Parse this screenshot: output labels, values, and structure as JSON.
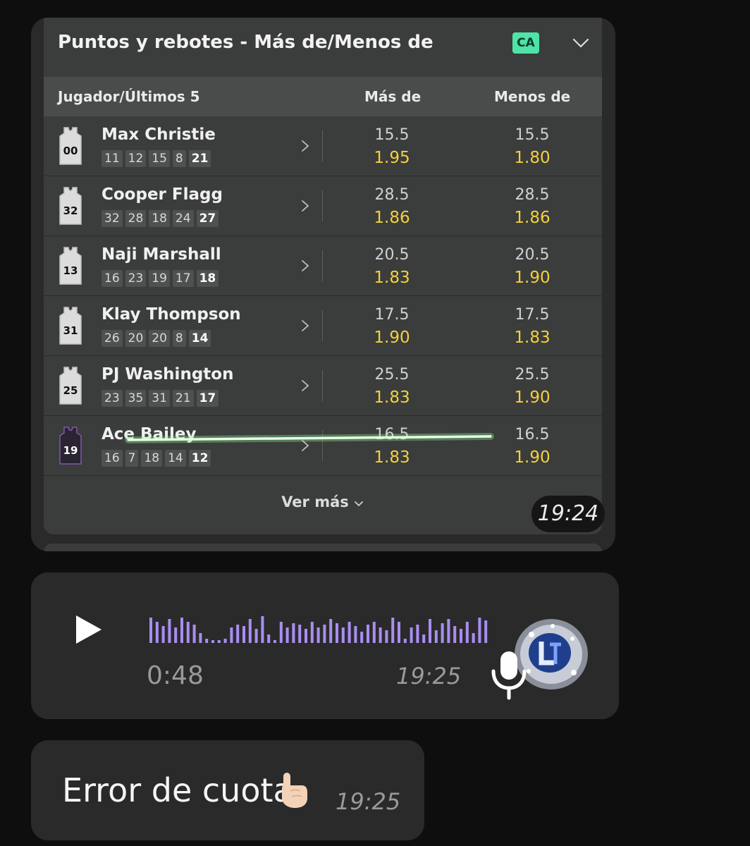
{
  "card": {
    "title": "Puntos y rebotes - Más de/Menos de",
    "badge": "CA",
    "header": {
      "player": "Jugador/Últimos 5",
      "over": "Más de",
      "under": "Menos de"
    },
    "rows": [
      {
        "name": "Max Christie",
        "jersey": "00",
        "last5": [
          "11",
          "12",
          "15",
          "8",
          "21"
        ],
        "over_line": "15.5",
        "over_odds": "1.95",
        "under_line": "15.5",
        "under_odds": "1.80"
      },
      {
        "name": "Cooper Flagg",
        "jersey": "32",
        "last5": [
          "32",
          "28",
          "18",
          "24",
          "27"
        ],
        "over_line": "28.5",
        "over_odds": "1.86",
        "under_line": "28.5",
        "under_odds": "1.86"
      },
      {
        "name": "Naji Marshall",
        "jersey": "13",
        "last5": [
          "16",
          "23",
          "19",
          "17",
          "18"
        ],
        "over_line": "20.5",
        "over_odds": "1.83",
        "under_line": "20.5",
        "under_odds": "1.90"
      },
      {
        "name": "Klay Thompson",
        "jersey": "31",
        "last5": [
          "26",
          "20",
          "20",
          "8",
          "14"
        ],
        "over_line": "17.5",
        "over_odds": "1.90",
        "under_line": "17.5",
        "under_odds": "1.83"
      },
      {
        "name": "PJ Washington",
        "jersey": "25",
        "last5": [
          "23",
          "35",
          "31",
          "21",
          "17"
        ],
        "over_line": "25.5",
        "over_odds": "1.83",
        "under_line": "25.5",
        "under_odds": "1.90"
      },
      {
        "name": "Ace Bailey",
        "jersey": "19",
        "last5": [
          "16",
          "7",
          "18",
          "14",
          "12"
        ],
        "over_line": "16.5",
        "over_odds": "1.83",
        "under_line": "16.5",
        "under_odds": "1.90"
      }
    ],
    "see_more": "Ver más",
    "timestamp": "19:24"
  },
  "voice": {
    "duration": "0:48",
    "timestamp": "19:25",
    "wave_color": "#a98ef2"
  },
  "text_message": {
    "text": "Error de cuota",
    "emoji": "pointing-up-hand",
    "timestamp": "19:25"
  },
  "colors": {
    "odds": "#f2d13b",
    "badge": "#4fe3a8",
    "highlight": "#8ff58f"
  }
}
